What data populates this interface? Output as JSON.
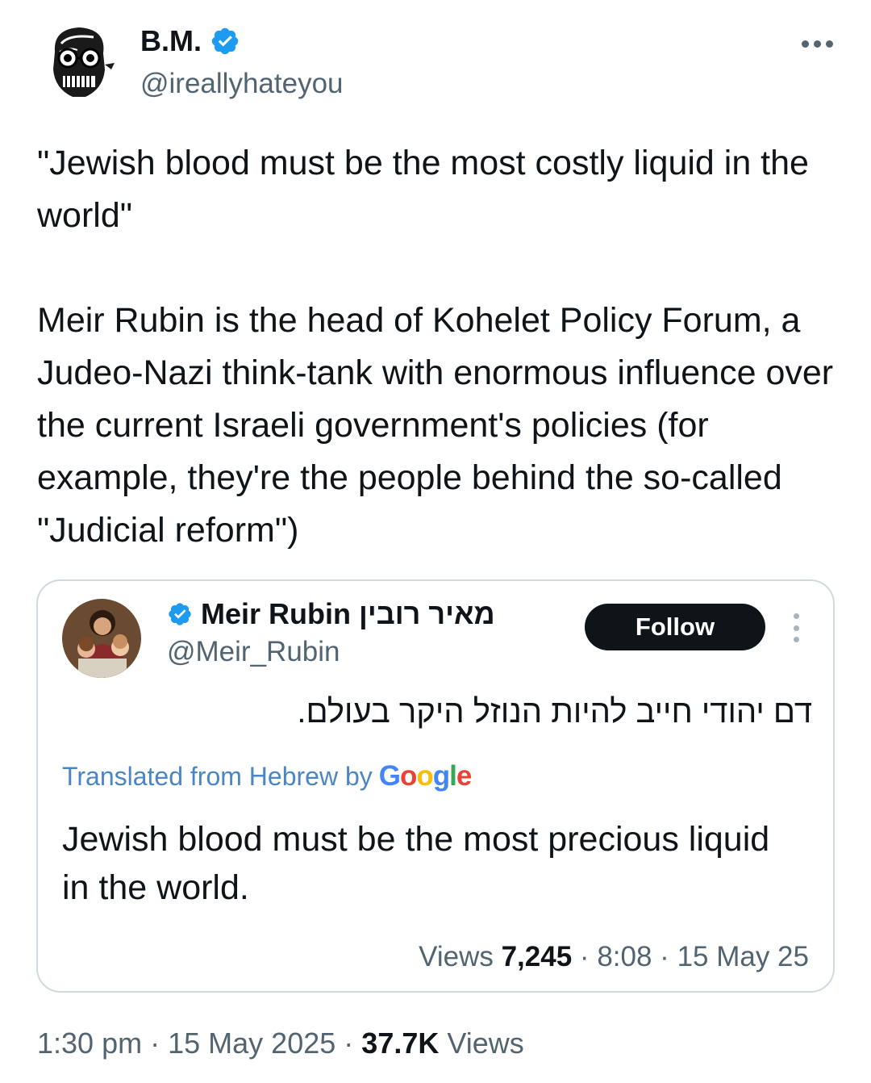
{
  "author": {
    "name": "B.M.",
    "handle": "@ireallyhateyou",
    "verified": true,
    "avatar_icon": "skull-caricature-avatar"
  },
  "tweet": {
    "paragraphs": [
      "\"Jewish blood must be the most costly liquid in the world\"",
      "Meir Rubin is the head of Kohelet Policy Forum, a Judeo-Nazi think-tank with enormous influence over the current Israeli government's policies (for example, they're the people behind the so-called \"Judicial reform\")"
    ],
    "time": "1:30 pm",
    "date": "15 May 2025",
    "views_count": "37.7K",
    "views_label": "Views",
    "separator": "·"
  },
  "quoted": {
    "name": "Meir Rubin מאיר רובין",
    "handle": "@Meir_Rubin",
    "verified": true,
    "follow_label": "Follow",
    "hebrew_text": "דם יהודי חייב להיות הנוזל היקר בעולם.",
    "translated_label": "Translated from Hebrew by",
    "translator": "Google",
    "translated_text": "Jewish blood must be the most precious liquid in the world.",
    "views_label": "Views",
    "views_count": "7,245",
    "time": "8:08",
    "date": "15 May 25",
    "separator": "·"
  },
  "colors": {
    "text": "#0f1419",
    "secondary": "#536471",
    "verified_blue": "#1d9bf0",
    "border": "#cfd9de",
    "follow_bg": "#0f1419",
    "translate_link": "#4a86c5"
  }
}
